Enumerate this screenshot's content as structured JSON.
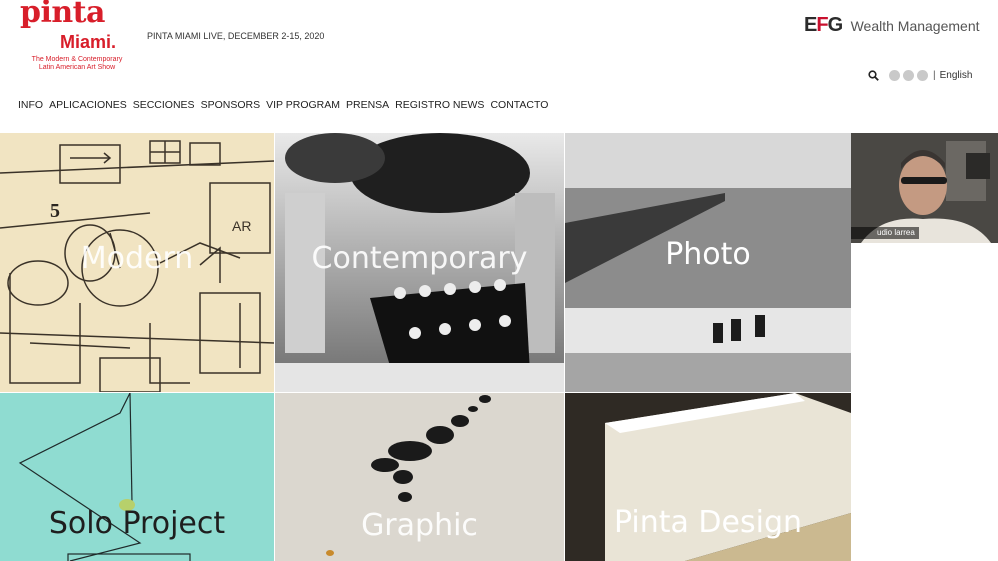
{
  "brand": {
    "name": "pinta",
    "city": "Miami.",
    "tagline_line1": "The Modern & Contemporary",
    "tagline_line2": "Latin American Art Show"
  },
  "event": {
    "text": "PINTA MIAMI LIVE, DECEMBER 2-15, 2020"
  },
  "sponsor": {
    "mark": "EFG",
    "text": "Wealth Management"
  },
  "utility": {
    "search_icon": "search-icon",
    "social_icons": [
      "facebook-icon",
      "twitter-icon",
      "instagram-icon"
    ],
    "separator": "|",
    "language": "English"
  },
  "nav": {
    "items": [
      "INFO",
      "APLICACIONES",
      "SECCIONES",
      "SPONSORS",
      "VIP PROGRAM",
      "PRENSA",
      "REGISTRO NEWS",
      "CONTACTO"
    ]
  },
  "sections": [
    {
      "label": "Modern"
    },
    {
      "label": "Contemporary"
    },
    {
      "label": "Photo"
    },
    {
      "label": "Solo Project"
    },
    {
      "label": "Graphic"
    },
    {
      "label": "Pinta Design"
    }
  ],
  "video": {
    "participant_name": "udio larrea"
  },
  "colors": {
    "brand_red": "#d81e2a",
    "text_dark": "#1a1a1a",
    "solo_teal": "#8fdcd1"
  }
}
